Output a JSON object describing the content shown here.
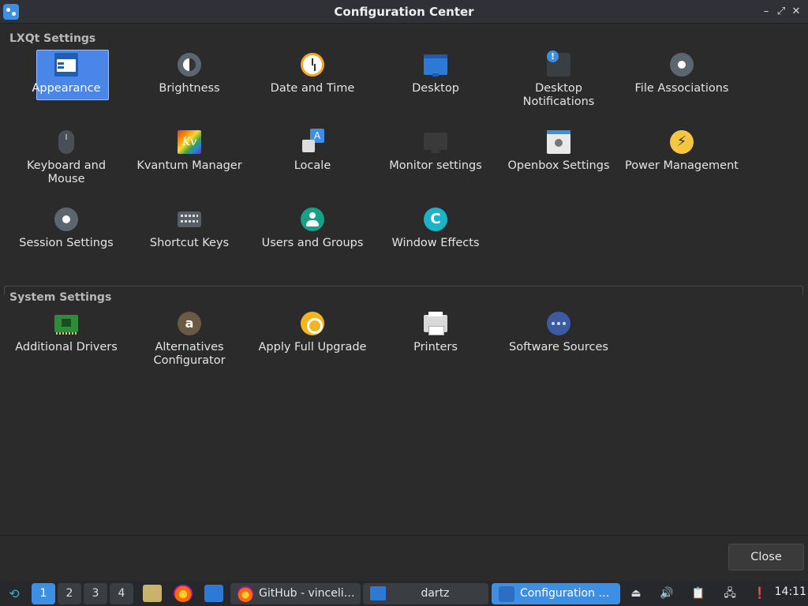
{
  "window": {
    "title": "Configuration Center",
    "minimize_glyph": "–",
    "maximize_glyph": "⤢",
    "close_glyph": "✕"
  },
  "lxqt": {
    "title": "LXQt Settings",
    "items": [
      {
        "label": "Appearance",
        "icon": "appearance-icon"
      },
      {
        "label": "Brightness",
        "icon": "brightness-icon"
      },
      {
        "label": "Date and Time",
        "icon": "clock-icon"
      },
      {
        "label": "Desktop",
        "icon": "desktop-icon"
      },
      {
        "label": "Desktop\nNotifications",
        "icon": "notification-icon"
      },
      {
        "label": "File Associations",
        "icon": "gear-icon"
      },
      {
        "label": "Keyboard and\nMouse",
        "icon": "mouse-icon"
      },
      {
        "label": "Kvantum Manager",
        "icon": "kvantum-icon"
      },
      {
        "label": "Locale",
        "icon": "locale-icon"
      },
      {
        "label": "Monitor settings",
        "icon": "monitor-icon"
      },
      {
        "label": "Openbox Settings",
        "icon": "openbox-icon"
      },
      {
        "label": "Power Management",
        "icon": "power-icon"
      },
      {
        "label": "Session Settings",
        "icon": "gear-icon"
      },
      {
        "label": "Shortcut Keys",
        "icon": "keyboard-icon"
      },
      {
        "label": "Users and Groups",
        "icon": "users-icon"
      },
      {
        "label": "Window Effects",
        "icon": "effects-icon"
      }
    ],
    "kvantum_glyph": "Kv",
    "power_glyph": "⚡",
    "effects_glyph": "C"
  },
  "system": {
    "title": "System Settings",
    "items": [
      {
        "label": "Additional Drivers",
        "icon": "drivers-icon"
      },
      {
        "label": "Alternatives\nConfigurator",
        "icon": "alternatives-icon"
      },
      {
        "label": "Apply Full Upgrade",
        "icon": "upgrade-icon"
      },
      {
        "label": "Printers",
        "icon": "printer-icon"
      },
      {
        "label": "Software Sources",
        "icon": "sources-icon"
      }
    ],
    "alternatives_glyph": "a"
  },
  "dialog": {
    "close_label": "Close"
  },
  "taskbar": {
    "menu_glyph": "⟲",
    "workspaces": [
      "1",
      "2",
      "3",
      "4"
    ],
    "active_workspace": "1",
    "tasks": [
      {
        "label": "GitHub - vinceli…",
        "icon": "firefox-icon"
      },
      {
        "label": "dartz",
        "icon": "folder-icon"
      },
      {
        "label": "Configuration …",
        "icon": "configuration-center-icon"
      }
    ],
    "tray_glyphs": {
      "eject": "⏏",
      "volume": "🔊",
      "clipboard": "📋",
      "network": "🖧",
      "updates": "❗"
    },
    "clock": "14:11"
  },
  "colors": {
    "accent": "#3d8ee5",
    "selection": "#4a86e8",
    "background": "#2b2b2b"
  }
}
